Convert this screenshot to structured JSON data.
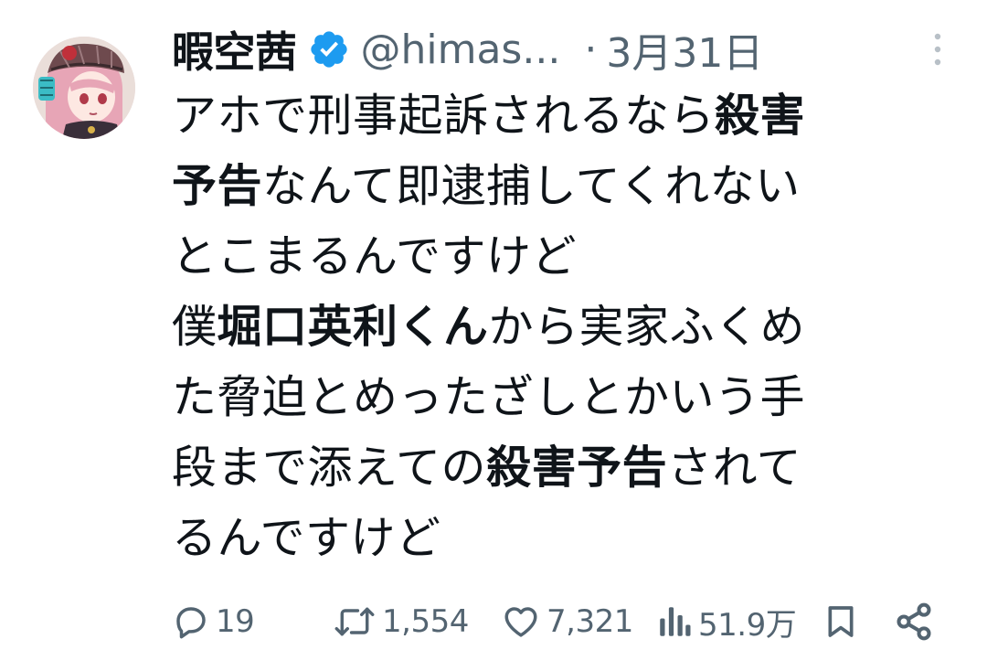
{
  "author": {
    "display_name": "暇空茜",
    "handle": "@himas...",
    "separator": "·",
    "date": "3月31日"
  },
  "tweet": {
    "lines": [
      [
        {
          "t": "アホで刑事起訴されるなら",
          "b": false
        },
        {
          "t": "殺害",
          "b": true
        }
      ],
      [
        {
          "t": "予告",
          "b": true
        },
        {
          "t": "なんて即逮捕してくれない",
          "b": false
        }
      ],
      [
        {
          "t": "とこまるんですけど",
          "b": false
        }
      ],
      [
        {
          "t": "僕",
          "b": false
        },
        {
          "t": "堀口英利くん",
          "b": true
        },
        {
          "t": "から実家ふくめ",
          "b": false
        }
      ],
      [
        {
          "t": "た脅迫とめったざしとかいう手",
          "b": false
        }
      ],
      [
        {
          "t": "段まで添えての",
          "b": false
        },
        {
          "t": "殺害予告",
          "b": true
        },
        {
          "t": "されて",
          "b": false
        }
      ],
      [
        {
          "t": "るんですけど",
          "b": false
        }
      ]
    ]
  },
  "actions": {
    "replies": "19",
    "retweets": "1,554",
    "likes": "7,321",
    "views": "51.9万"
  },
  "icons": {
    "verified": "verified-badge-icon",
    "more": "more-vertical-icon",
    "reply": "reply-icon",
    "retweet": "retweet-icon",
    "like": "heart-icon",
    "views": "views-icon",
    "bookmark": "bookmark-icon",
    "share": "share-icon"
  },
  "colors": {
    "text": "#0f1419",
    "secondary": "#536471",
    "verified": "#1d9bf0"
  }
}
